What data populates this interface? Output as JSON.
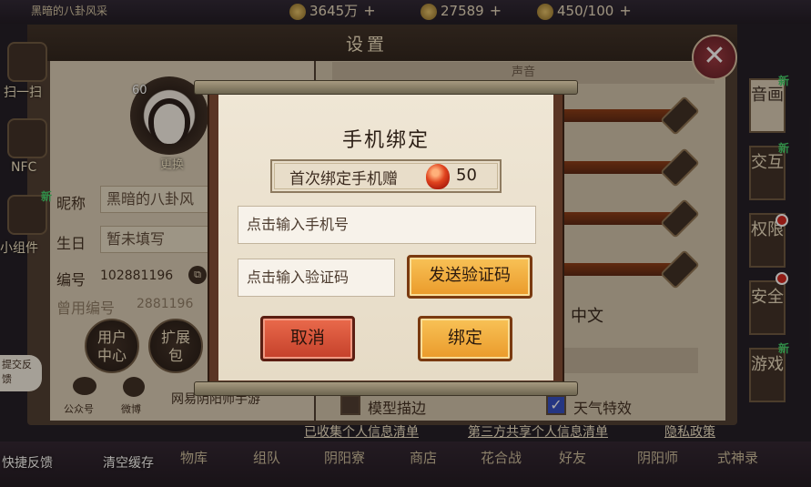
{
  "topbar": {
    "player_name_partial": "黑暗的八卦风采",
    "coins": "3645万",
    "jade": "27589",
    "stamina": "450/100"
  },
  "settings": {
    "title": "设置",
    "sound_header": "声音",
    "avatar_level": "60",
    "change_avatar": "更换",
    "nickname_label": "昵称",
    "nickname_value": "黑暗的八卦风",
    "birthday_label": "生日",
    "birthday_value": "暂未填写",
    "id_label": "编号",
    "id_value": "102881196",
    "old_id_label": "曾用编号",
    "old_id_value": "2881196",
    "user_center": "用户\n中心",
    "expand_pack": "扩展\n包",
    "wechat_label": "公众号",
    "weibo_label": "微博",
    "brand_text": "网易阴阳师手游",
    "language_value": "中文",
    "model_stroke": "模型描边",
    "weather_effect": "天气特效"
  },
  "side_icons": {
    "scan": "扫一扫",
    "nfc": "NFC",
    "widget": "小组件",
    "new_badge": "新"
  },
  "tabs": [
    {
      "label": "音画"
    },
    {
      "label": "交互"
    },
    {
      "label": "权限"
    },
    {
      "label": "安全"
    },
    {
      "label": "游戏"
    }
  ],
  "new_tag": "新",
  "bottom_links": {
    "collect": "已收集个人信息清单",
    "share": "第三方共享个人信息清单",
    "privacy": "隐私政策"
  },
  "bottom_nav": {
    "quick_feedback": "快捷反馈",
    "clear_cache": "清空缓存",
    "feedback_bubble": "提交反馈",
    "items": [
      "物库",
      "组队",
      "阴阳寮",
      "商店",
      "花合战",
      "好友",
      "阴阳师",
      "式神录"
    ]
  },
  "modal": {
    "title": "手机绑定",
    "reward_text": "首次绑定手机赠",
    "reward_amount": "50",
    "phone_placeholder": "点击输入手机号",
    "code_placeholder": "点击输入验证码",
    "send_code": "发送验证码",
    "cancel": "取消",
    "bind": "绑定"
  },
  "colors": {
    "cancel_red": "#e05a3e",
    "confirm_orange": "#f2b048",
    "paper": "#ece3d1",
    "frame_brown": "#5a3524"
  }
}
